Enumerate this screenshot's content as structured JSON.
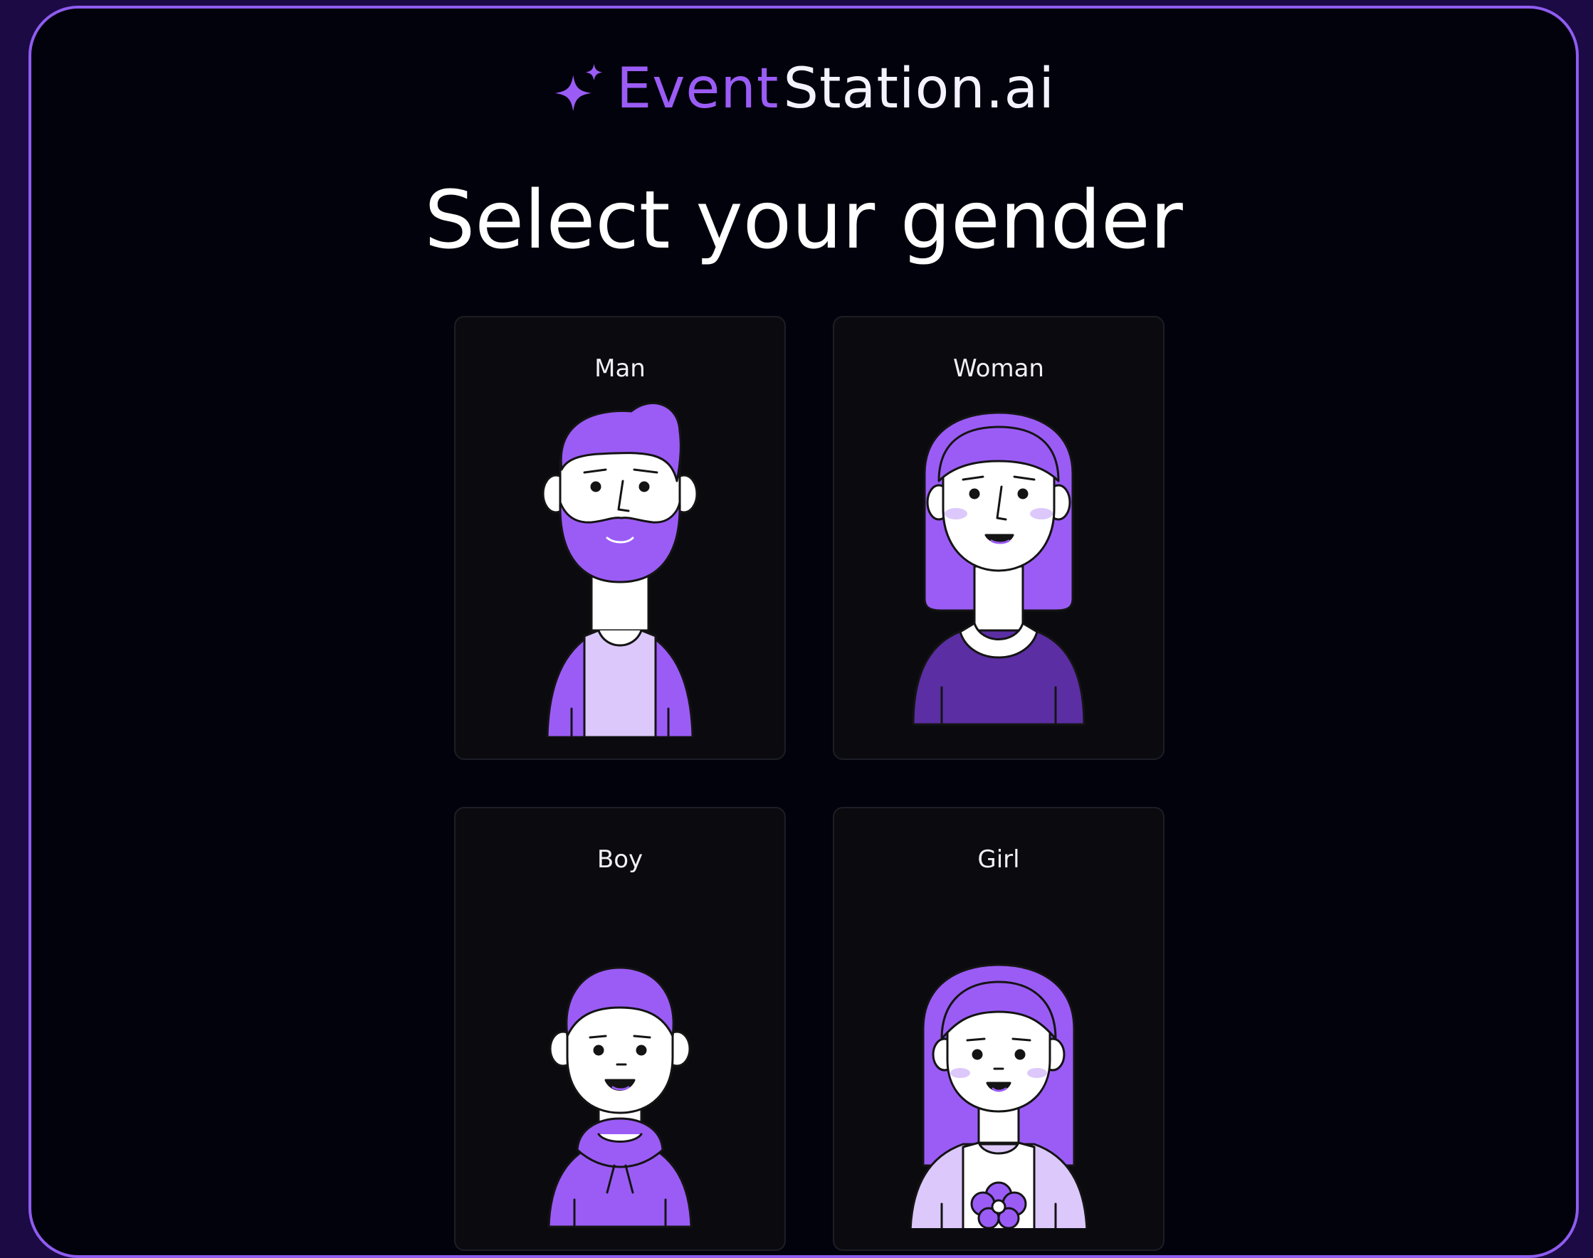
{
  "brand": {
    "name_part1": "Event",
    "name_part2": "Station.ai",
    "icon": "sparkle-icon",
    "accent_color": "#9b5cf6"
  },
  "page": {
    "title": "Select your gender"
  },
  "options": [
    {
      "label": "Man",
      "icon": "man-avatar-icon"
    },
    {
      "label": "Woman",
      "icon": "woman-avatar-icon"
    },
    {
      "label": "Boy",
      "icon": "boy-avatar-icon"
    },
    {
      "label": "Girl",
      "icon": "girl-avatar-icon"
    }
  ],
  "colors": {
    "background": "#02020c",
    "border": "#8f5cf0",
    "card": "#0b0b0f",
    "purple": "#9b5cf6",
    "dark_purple": "#5b2ea3",
    "light_purple": "#dcc8fb"
  }
}
